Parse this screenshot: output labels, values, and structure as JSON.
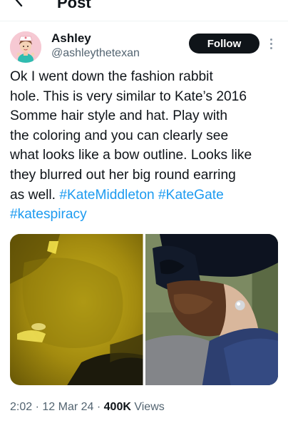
{
  "header": {
    "title": "Post",
    "back_icon": "arrow-left-icon"
  },
  "author": {
    "display_name": "Ashley",
    "handle": "@ashleythetexan",
    "avatar_icon": "nurse-avatar",
    "follow_label": "Follow",
    "more_icon": "vertical-dots-icon"
  },
  "tweet": {
    "lines": [
      "Ok I went down the fashion rabbit",
      "hole. This is very similar to Kate’s 2016",
      "Somme hair style and hat. Play with",
      "the coloring and you can clearly see",
      "what looks like a bow outline. Looks like",
      "they blurred out her big round earring"
    ],
    "line7_text": "as well.",
    "hashtags": [
      "#KateMiddleton",
      "#KateGate",
      "#katespiracy"
    ]
  },
  "media": [
    {
      "description_icon": "yellow-tinted-photo"
    },
    {
      "description_icon": "woman-hat-bow-photo"
    }
  ],
  "meta": {
    "time": "2:02",
    "date": "12 Mar 24",
    "views_count": "400K",
    "views_label": "Views",
    "separator": "·"
  },
  "colors": {
    "link": "#1d9bf0",
    "text": "#0f1419",
    "muted": "#536471",
    "button_bg": "#0f1419"
  }
}
